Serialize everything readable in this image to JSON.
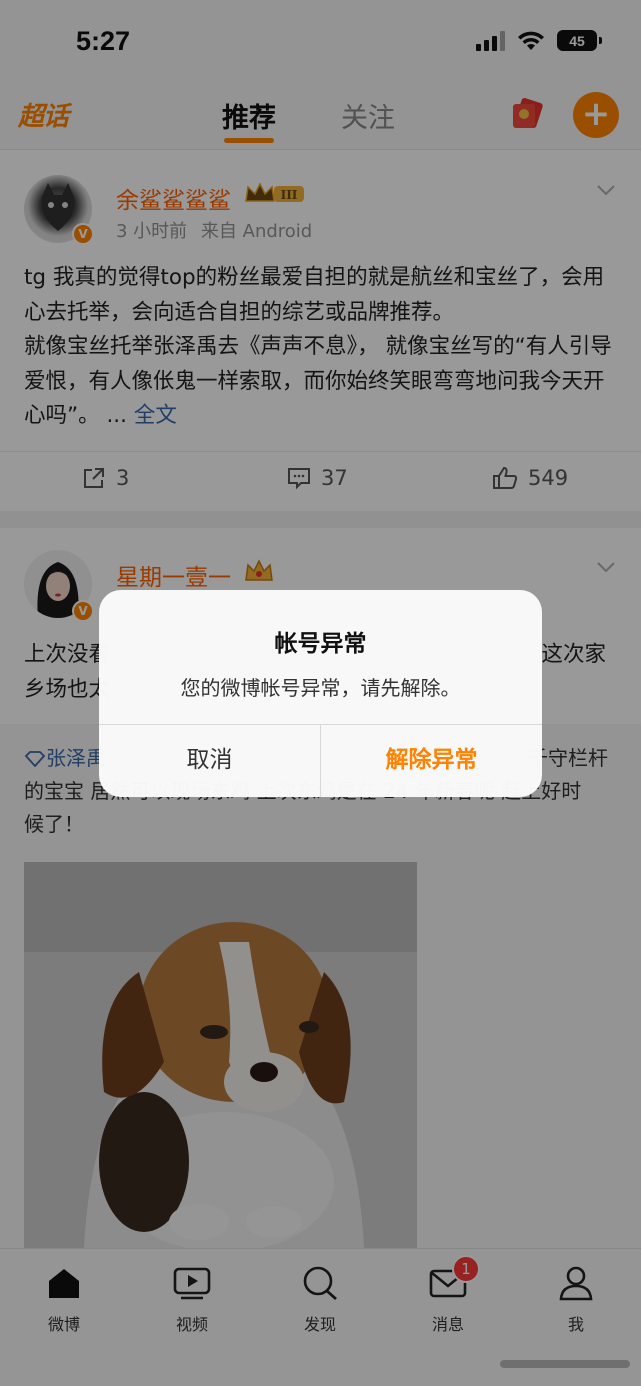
{
  "status_bar": {
    "time": "5:27",
    "battery": "45"
  },
  "top_nav": {
    "logo": "超话",
    "tabs": [
      {
        "label": "推荐",
        "active": true
      },
      {
        "label": "关注",
        "active": false
      }
    ],
    "add_label": "+"
  },
  "posts": [
    {
      "username": "余鲨鲨鲨鲨",
      "rank": "III",
      "time": "3 小时前",
      "source": "来自 Android",
      "text": "tg 我真的觉得top的粉丝最爱自担的就是航丝和宝丝了，会用心去托举，会向适合自担的综艺或品牌推荐。\n就像宝丝托举张泽禹去《声声不息》， 就像宝丝写的“有人引导爱恨，有人像伥鬼一样索取，而你始终笑眼弯弯地问我今天开心吗”。 ... ",
      "full_text_link": "全文",
      "reposts": "3",
      "comments": "37",
      "likes": "549"
    },
    {
      "username": "星期一壹一",
      "text_left": "上次没看",
      "text_right": "这次家",
      "text_line2": "乡场也太",
      "repost_topic": "张泽禹",
      "repost_tail": "千守栏杆",
      "repost_line2": "的宝宝 居然可以现场东鸡 上次东鸡是在 24 年新春呢 赶上好时",
      "repost_line3": "候了！"
    }
  ],
  "dialog": {
    "title": "帐号异常",
    "message": "您的微博帐号异常，请先解除。",
    "cancel": "取消",
    "confirm": "解除异常"
  },
  "tab_bar": {
    "items": [
      {
        "label": "微博",
        "icon": "home-icon"
      },
      {
        "label": "视频",
        "icon": "video-icon"
      },
      {
        "label": "发现",
        "icon": "search-icon"
      },
      {
        "label": "消息",
        "icon": "mail-icon",
        "badge": "1"
      },
      {
        "label": "我",
        "icon": "profile-icon"
      }
    ]
  },
  "colors": {
    "accent": "#ff8200",
    "link": "#3a68a8",
    "username": "#ff6200"
  }
}
